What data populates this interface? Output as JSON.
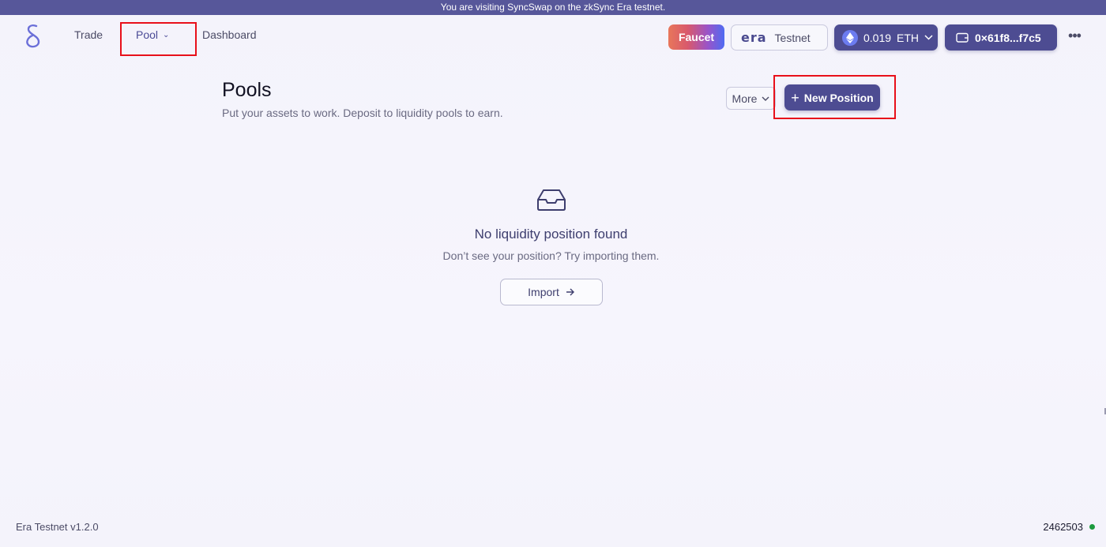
{
  "banner": {
    "text": "You are visiting SyncSwap on the zkSync Era testnet."
  },
  "nav": {
    "trade": "Trade",
    "pool": "Pool",
    "dashboard": "Dashboard"
  },
  "header": {
    "faucet_label": "Faucet",
    "era_label": "era",
    "network_label": "Testnet",
    "balance_amount": "0.019",
    "balance_token": "ETH",
    "wallet_address": "0×61f8...f7c5"
  },
  "pools": {
    "title": "Pools",
    "subtitle": "Put your assets to work. Deposit to liquidity pools to earn.",
    "more_label": "More",
    "new_position_label": "New Position"
  },
  "empty_state": {
    "title": "No liquidity position found",
    "subtitle": "Don’t see your position? Try importing them.",
    "import_label": "Import"
  },
  "footer": {
    "version": "Era Testnet v1.2.0",
    "block_number": "2462503"
  },
  "colors": {
    "banner": "#57579a",
    "primary": "#4d4c92",
    "highlight": "#e8101a",
    "status_ok": "#1c9a3e"
  },
  "icons": {
    "logo": "syncswap-logo-icon",
    "chevron": "chevron-down-icon",
    "eth": "ethereum-icon",
    "wallet": "wallet-icon",
    "more": "more-dots-icon",
    "plus": "plus-icon",
    "inbox": "inbox-icon",
    "arrow": "arrow-right-icon"
  }
}
